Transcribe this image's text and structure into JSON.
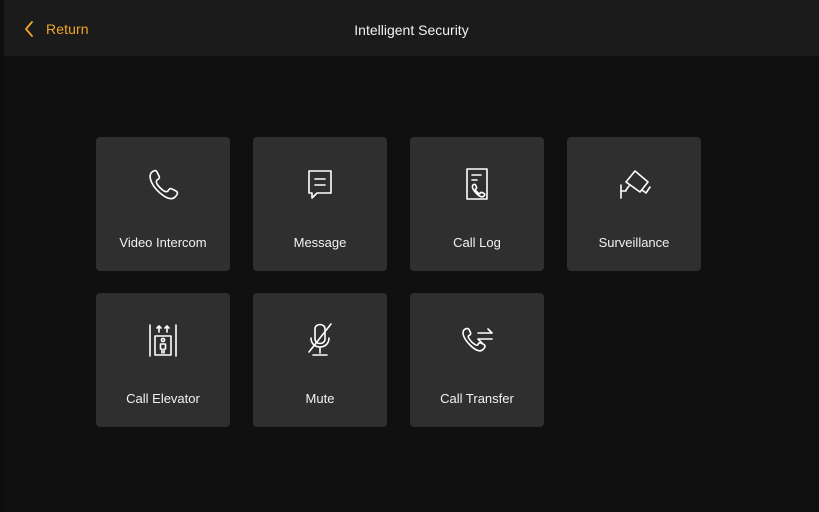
{
  "header": {
    "back_label": "Return",
    "title": "Intelligent Security"
  },
  "colors": {
    "accent": "#f0a52b",
    "background": "#101010",
    "topbar": "#1b1b1b",
    "tile": "#2f2f2f",
    "text": "#f2f2f2"
  },
  "tiles": [
    {
      "label": "Video Intercom",
      "icon": "phone-handset-icon"
    },
    {
      "label": "Message",
      "icon": "message-bubble-icon"
    },
    {
      "label": "Call Log",
      "icon": "call-log-icon"
    },
    {
      "label": "Surveillance",
      "icon": "surveillance-camera-icon"
    },
    {
      "label": "Call Elevator",
      "icon": "elevator-icon"
    },
    {
      "label": "Mute",
      "icon": "microphone-muted-icon"
    },
    {
      "label": "Call Transfer",
      "icon": "call-transfer-icon"
    }
  ]
}
